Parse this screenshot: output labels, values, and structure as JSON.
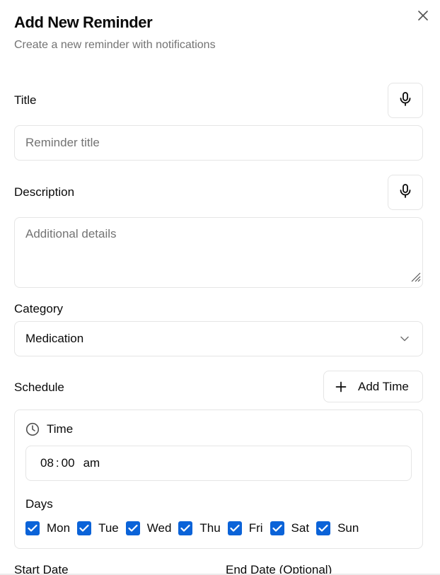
{
  "dialog": {
    "title": "Add New Reminder",
    "subtitle": "Create a new reminder with notifications"
  },
  "fields": {
    "title_label": "Title",
    "title_placeholder": "Reminder title",
    "description_label": "Description",
    "description_placeholder": "Additional details",
    "category_label": "Category",
    "category_value": "Medication"
  },
  "schedule": {
    "label": "Schedule",
    "add_time_label": "Add Time",
    "time_label": "Time",
    "time_hour": "08",
    "time_sep": ":",
    "time_minute": "00",
    "time_period": "am",
    "days_label": "Days",
    "days": [
      {
        "label": "Mon",
        "checked": true
      },
      {
        "label": "Tue",
        "checked": true
      },
      {
        "label": "Wed",
        "checked": true
      },
      {
        "label": "Thu",
        "checked": true
      },
      {
        "label": "Fri",
        "checked": true
      },
      {
        "label": "Sat",
        "checked": true
      },
      {
        "label": "Sun",
        "checked": true
      }
    ]
  },
  "dates": {
    "start_label": "Start Date",
    "end_label": "End Date (Optional)"
  },
  "colors": {
    "accent": "#0b63d8",
    "border": "#e5e5e5",
    "muted": "#737373"
  },
  "icons": [
    "close-icon",
    "microphone-icon",
    "chevron-down-icon",
    "plus-icon",
    "clock-icon",
    "check-icon",
    "resize-handle-icon"
  ]
}
